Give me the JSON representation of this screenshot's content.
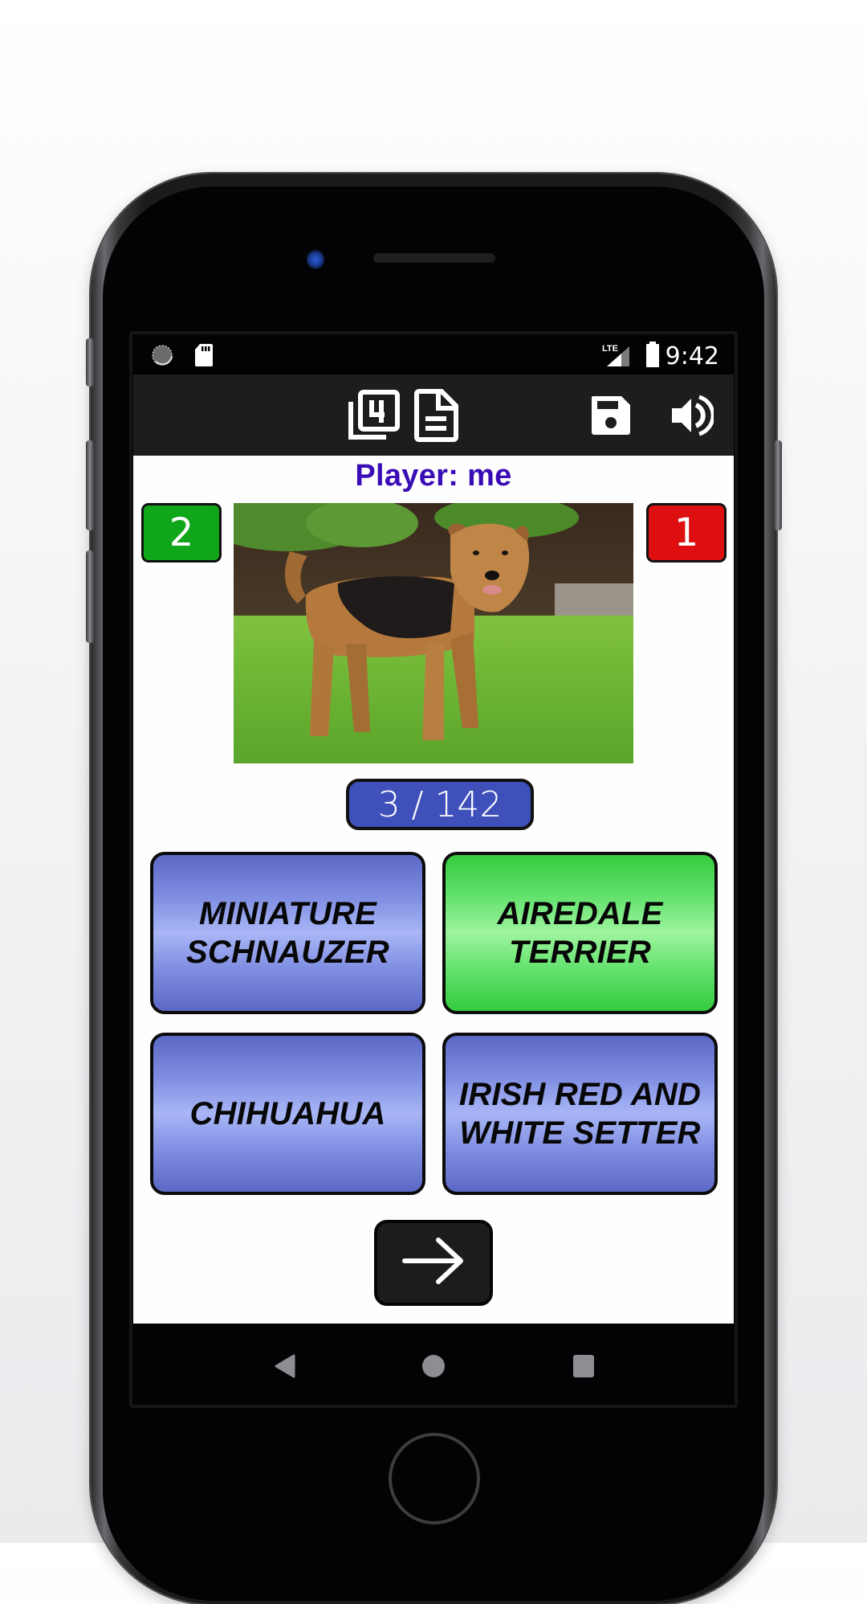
{
  "device": {
    "status_bar": {
      "left_icons": [
        "sync-icon",
        "sd-card-icon"
      ],
      "network_label": "LTE",
      "right_icons": [
        "lte-signal-icon",
        "battery-icon"
      ],
      "time": "9:42"
    },
    "nav_bar": {
      "buttons": [
        "back",
        "home",
        "recents"
      ]
    }
  },
  "app_bar": {
    "icons": [
      "filter-4-icon",
      "document-icon",
      "save-icon",
      "volume-icon"
    ]
  },
  "quiz": {
    "player_label": "Player:  me",
    "score_correct": "2",
    "score_wrong": "1",
    "image_subject": "Airedale Terrier dog standing on grass",
    "progress": "3 / 142",
    "progress_current": 3,
    "progress_total": 142,
    "answers": [
      {
        "label": "MINIATURE SCHNAUZER",
        "state": "default"
      },
      {
        "label": "AIREDALE TERRIER",
        "state": "correct"
      },
      {
        "label": "CHIHUAHUA",
        "state": "default"
      },
      {
        "label": "IRISH RED AND WHITE SETTER",
        "state": "default"
      }
    ],
    "next_button": "arrow-forward-icon"
  },
  "colors": {
    "correct_green": "#0fa61a",
    "wrong_red": "#de0f10",
    "player_text": "#3a0cb6",
    "counter_blue": "#3f50ba",
    "answer_blue": "#7c8ae0",
    "answer_green": "#5fe06a"
  }
}
